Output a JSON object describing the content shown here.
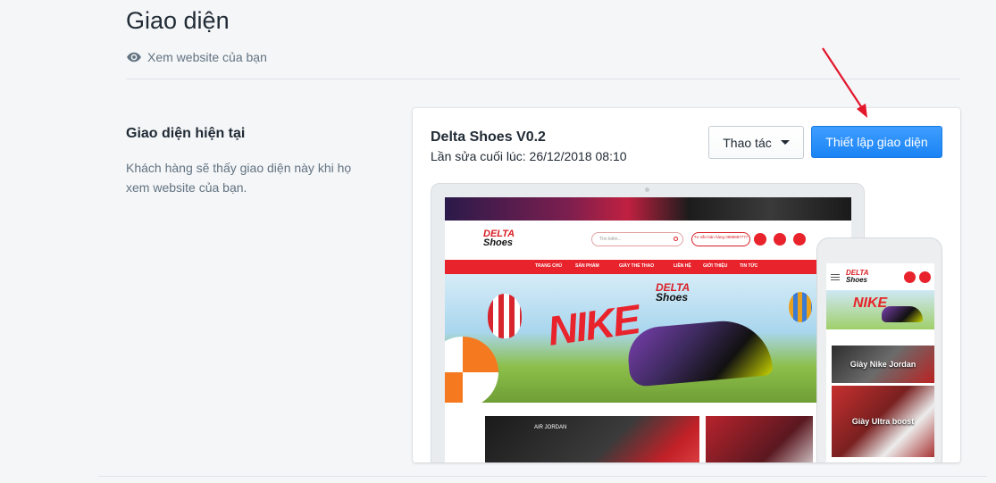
{
  "page": {
    "title": "Giao diện",
    "view_website": "Xem website của bạn"
  },
  "section": {
    "title": "Giao diện hiện tại",
    "description": "Khách hàng sẽ thấy giao diện này khi họ xem website của bạn."
  },
  "theme": {
    "name": "Delta Shoes V0.2",
    "last_edited": "Lần sửa cuối lúc: 26/12/2018 08:10",
    "actions_label": "Thao tác",
    "setup_label": "Thiết lập giao diện"
  },
  "preview": {
    "logo_top": "DELTA",
    "logo_bottom": "Shoes",
    "search_placeholder": "Tìm kiếm...",
    "hotline": "Tư vấn bán hàng 0988887777",
    "nav": [
      "TRANG CHỦ",
      "SẢN PHẨM",
      "GIÀY THỂ THAO",
      "LIÊN HỆ",
      "GIỚI THIỆU",
      "TIN TỨC"
    ],
    "hero_text": "NIKE",
    "product_label": "AIR JORDAN",
    "mobile_cards": [
      "Giày Nike Jordan",
      "Giày Ultra boost"
    ]
  },
  "colors": {
    "primary": "#1a84f4",
    "brand_red": "#e8232b",
    "annotation_arrow": "#e3162b"
  },
  "icons": {
    "view": "eye-icon",
    "caret": "caret-down-icon"
  }
}
